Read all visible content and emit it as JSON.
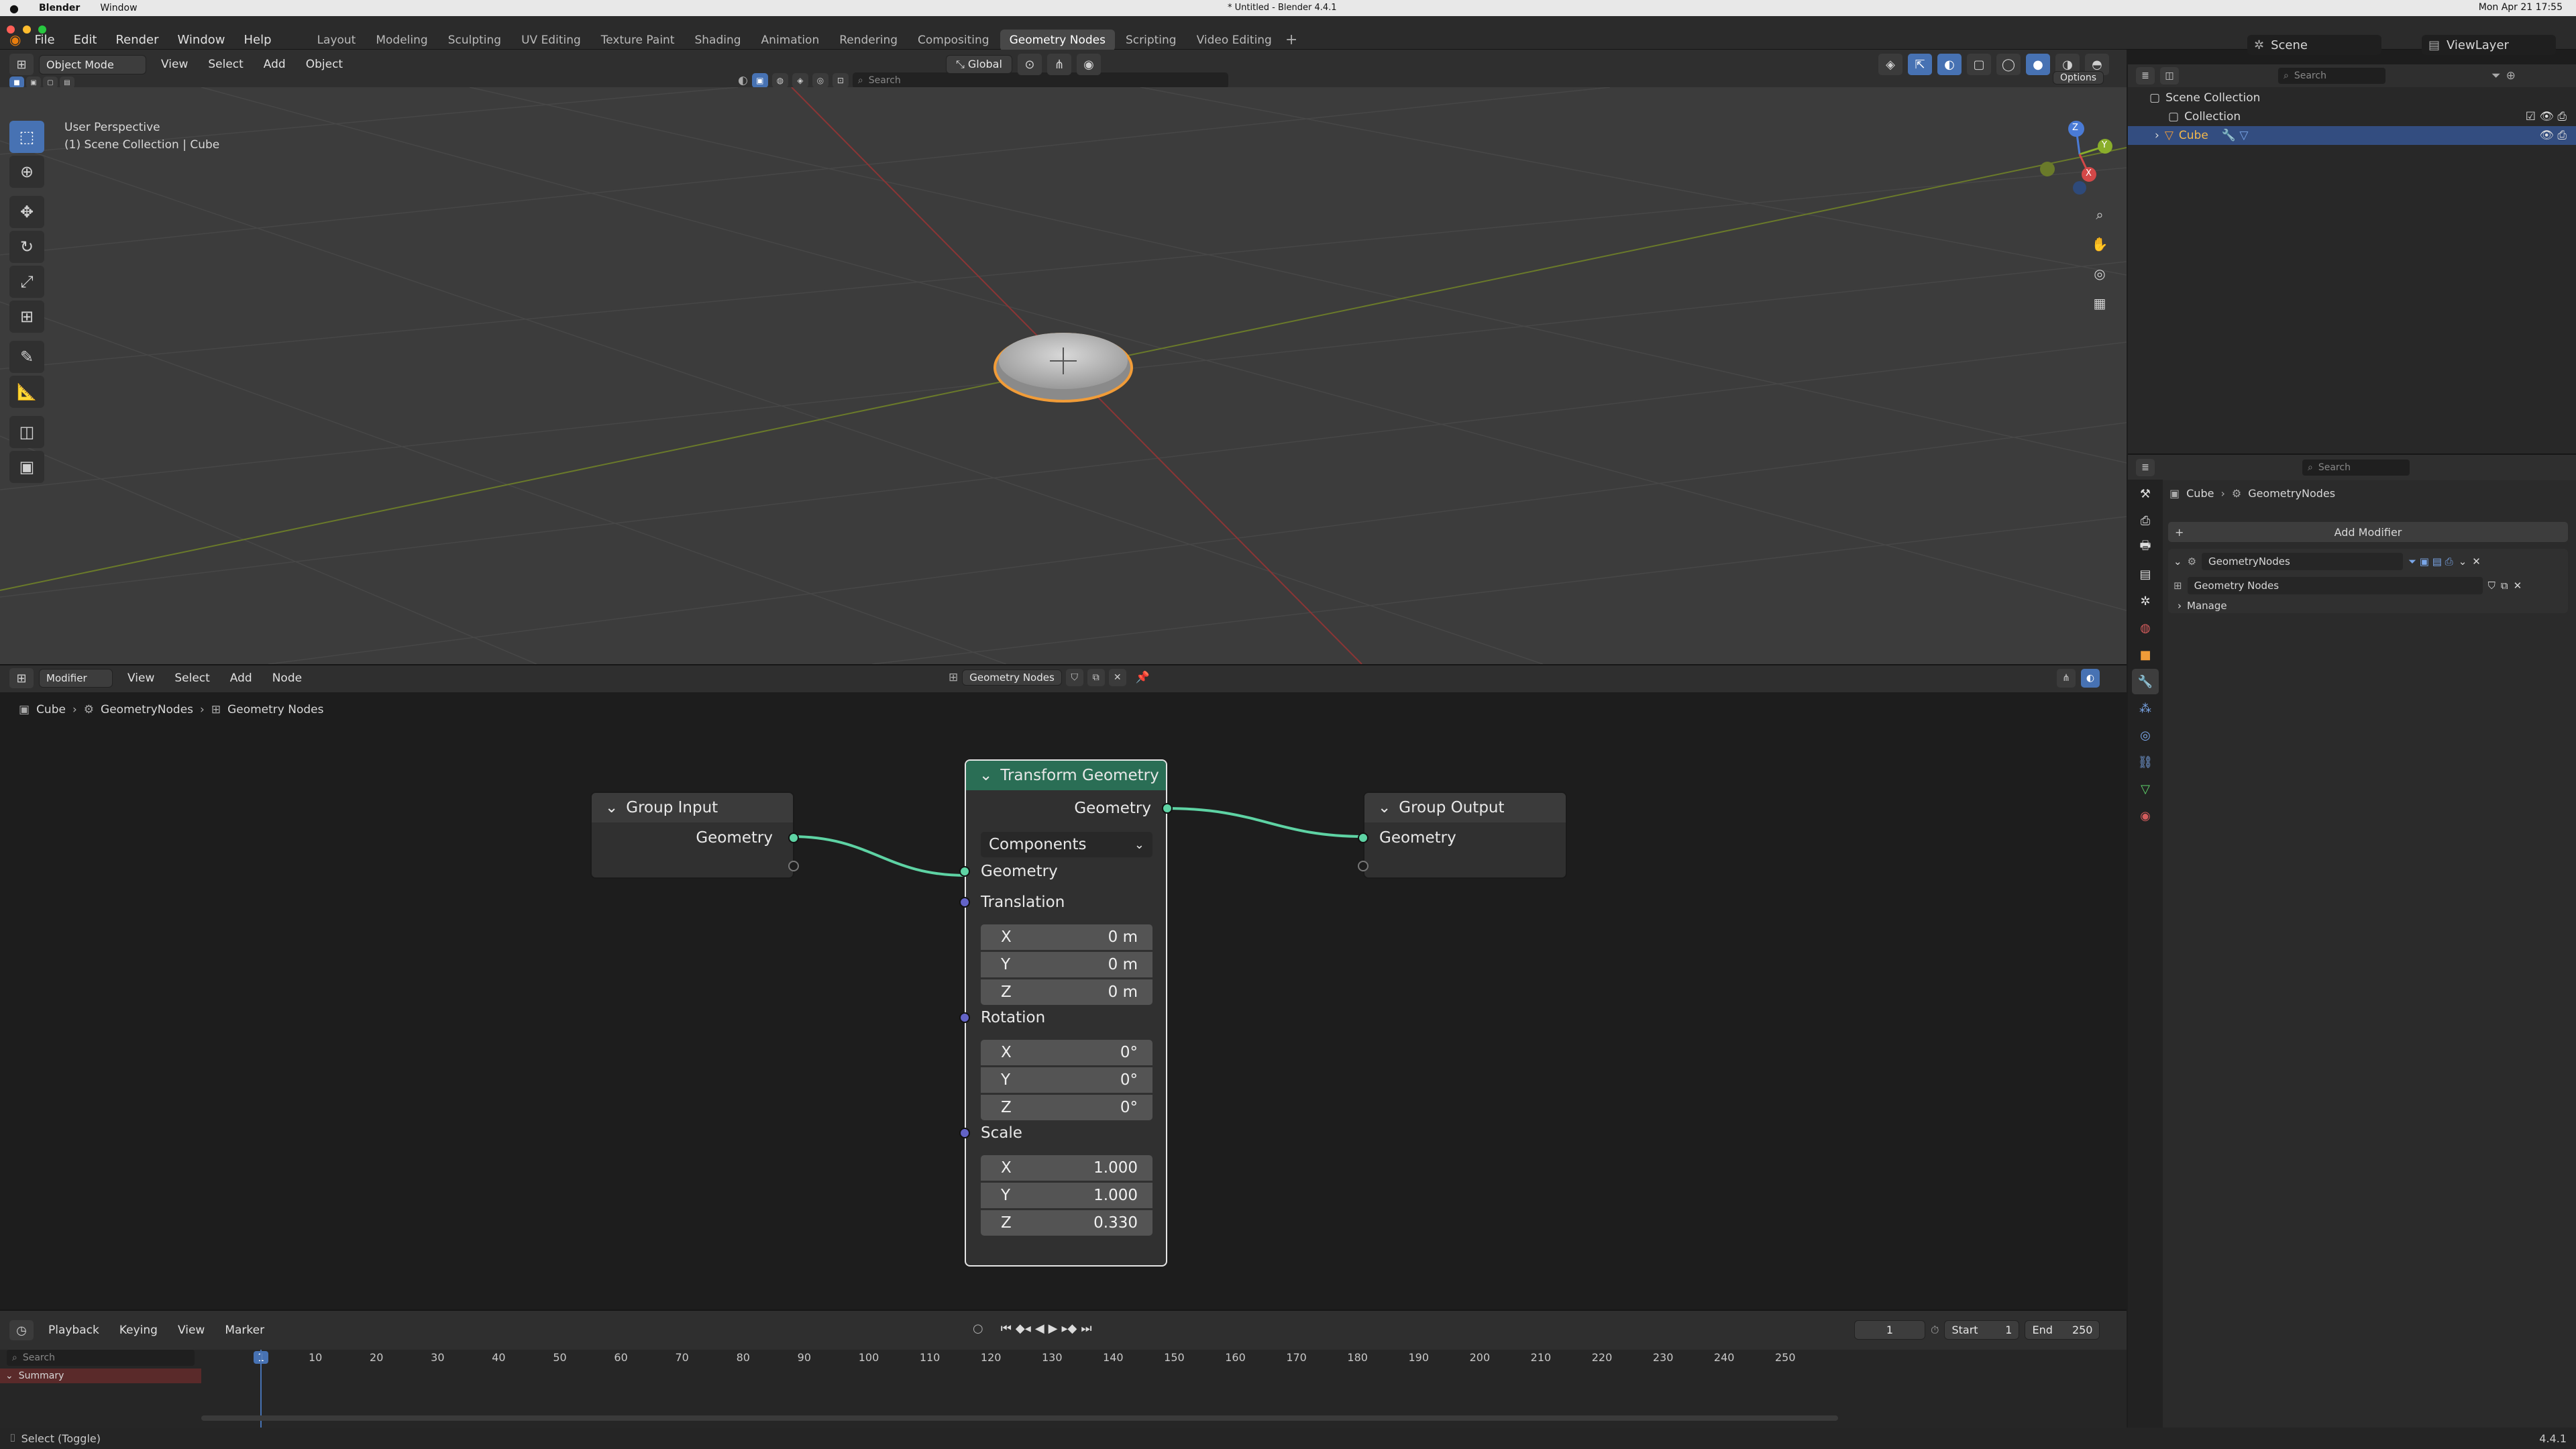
{
  "macbar": {
    "app": "Blender",
    "menu_window": "Window",
    "title": "* Untitled - Blender 4.4.1",
    "clock": "Mon Apr 21 17:55"
  },
  "topbar": {
    "menus": [
      "File",
      "Edit",
      "Render",
      "Window",
      "Help"
    ],
    "workspaces": [
      "Layout",
      "Modeling",
      "Sculpting",
      "UV Editing",
      "Texture Paint",
      "Shading",
      "Animation",
      "Rendering",
      "Compositing",
      "Geometry Nodes",
      "Scripting",
      "Video Editing"
    ],
    "active_workspace": "Geometry Nodes",
    "add_tab": "+",
    "scene_label": "Scene",
    "viewlayer_label": "ViewLayer"
  },
  "viewport": {
    "mode": "Object Mode",
    "menus": [
      "View",
      "Select",
      "Add",
      "Object"
    ],
    "transform": "Global",
    "search_placeholder": "Search",
    "options": "Options",
    "overlay_line1": "User Perspective",
    "overlay_line2": "(1) Scene Collection | Cube",
    "gizmo": {
      "z": "Z",
      "y": "Y",
      "x": "X"
    }
  },
  "node_editor": {
    "editor_type": "Modifier",
    "menus": [
      "View",
      "Select",
      "Add",
      "Node"
    ],
    "tree_name": "Geometry Nodes",
    "breadcrumb": [
      "Cube",
      "GeometryNodes",
      "Geometry Nodes"
    ],
    "group_input": {
      "title": "Group Input",
      "out_geometry": "Geometry"
    },
    "transform": {
      "title": "Transform Geometry",
      "out_geometry": "Geometry",
      "mode": "Components",
      "in_geometry": "Geometry",
      "translation_label": "Translation",
      "translation": [
        {
          "axis": "X",
          "value": "0 m"
        },
        {
          "axis": "Y",
          "value": "0 m"
        },
        {
          "axis": "Z",
          "value": "0 m"
        }
      ],
      "rotation_label": "Rotation",
      "rotation": [
        {
          "axis": "X",
          "value": "0°"
        },
        {
          "axis": "Y",
          "value": "0°"
        },
        {
          "axis": "Z",
          "value": "0°"
        }
      ],
      "scale_label": "Scale",
      "scale": [
        {
          "axis": "X",
          "value": "1.000"
        },
        {
          "axis": "Y",
          "value": "1.000"
        },
        {
          "axis": "Z",
          "value": "0.330"
        }
      ]
    },
    "group_output": {
      "title": "Group Output",
      "in_geometry": "Geometry"
    }
  },
  "timeline": {
    "menus": [
      "Playback",
      "Keying",
      "View",
      "Marker"
    ],
    "current_frame": "1",
    "start_label": "Start",
    "start": "1",
    "end_label": "End",
    "end": "250",
    "search_placeholder": "Search",
    "summary": "Summary",
    "ticks": [
      "1",
      "10",
      "20",
      "30",
      "40",
      "50",
      "60",
      "70",
      "80",
      "90",
      "100",
      "110",
      "120",
      "130",
      "140",
      "150",
      "160",
      "170",
      "180",
      "190",
      "200",
      "210",
      "220",
      "230",
      "240",
      "250"
    ]
  },
  "outliner": {
    "search_placeholder": "Search",
    "scene_collection": "Scene Collection",
    "collection": "Collection",
    "object": "Cube"
  },
  "properties": {
    "search_placeholder": "Search",
    "breadcrumb_object": "Cube",
    "breadcrumb_modifier": "GeometryNodes",
    "add_modifier": "Add Modifier",
    "modifier_name": "GeometryNodes",
    "node_group": "Geometry Nodes",
    "manage": "Manage"
  },
  "status": {
    "left": "Select (Toggle)",
    "version": "4.4.1"
  },
  "colors": {
    "accent": "#4772b3",
    "node_header_transform": "#2a6e55",
    "geometry_socket": "#5ed3a4",
    "vector_socket": "#6363c7",
    "selection_outline": "#f19c38"
  }
}
